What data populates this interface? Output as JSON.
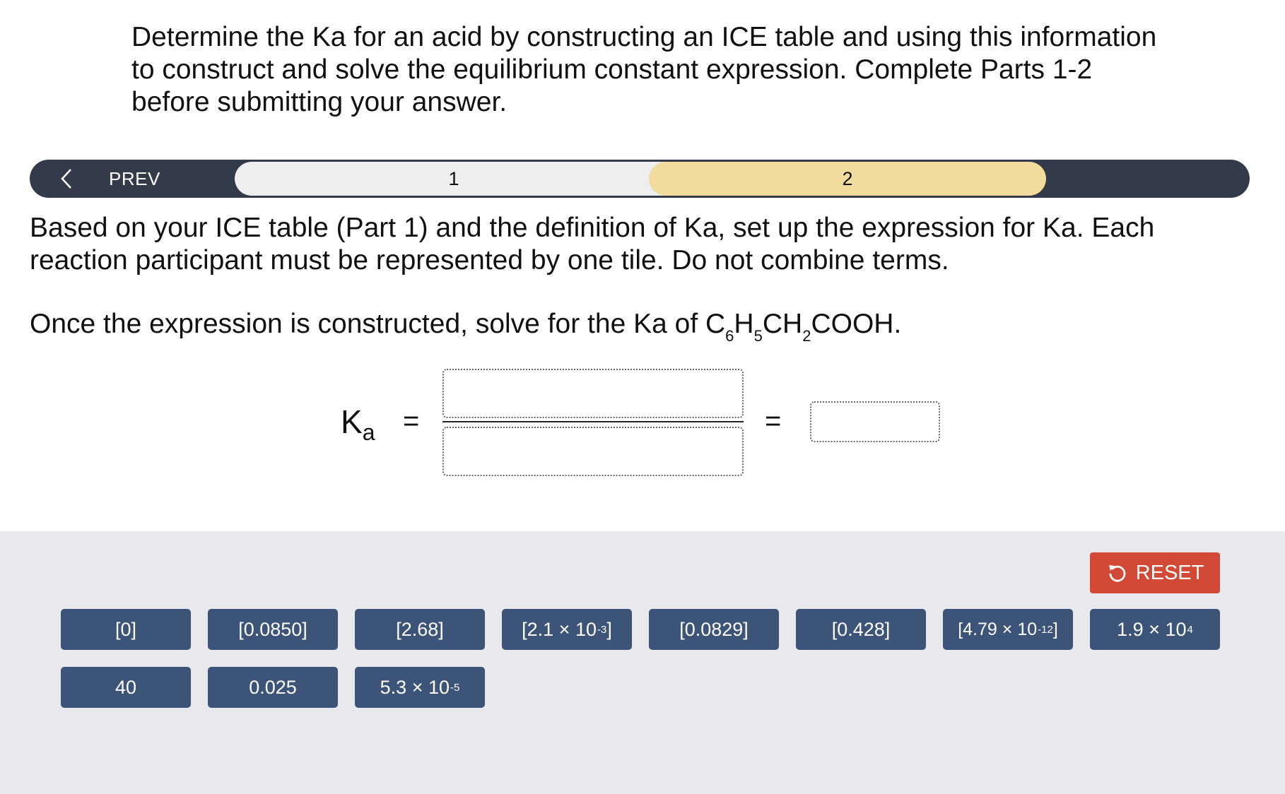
{
  "intro": "Determine the Ka for an acid by constructing an ICE table and using this information to construct and solve the equilibrium constant expression. Complete Parts 1-2 before submitting your answer.",
  "nav": {
    "prev_label": "PREV",
    "part1_label": "1",
    "part2_label": "2"
  },
  "instructions": {
    "line1": "Based on your ICE table (Part 1) and the definition of Ka, set up the expression for Ka. Each reaction participant must be represented by one tile. Do not combine terms.",
    "line2_prefix": "Once the expression is constructed, solve for the Ka of C",
    "formula_6": "6",
    "formula_H": "H",
    "formula_5": "5",
    "formula_CH": "CH",
    "formula_2": "2",
    "formula_COOH": "COOH."
  },
  "expression": {
    "ka_K": "K",
    "ka_sub": "a",
    "equals": "="
  },
  "reset_label": "RESET",
  "tiles": {
    "t0": "[0]",
    "t1": "[0.0850]",
    "t2": "[2.68]",
    "t3_base": "[2.1 × 10",
    "t3_exp": "-3",
    "t3_end": "]",
    "t4": "[0.0829]",
    "t5": "[0.428]",
    "t6_base": "[4.79 × 10",
    "t6_exp": "-12",
    "t6_end": "]",
    "t7_base": "1.9 × 10",
    "t7_exp": "4",
    "t8": "40",
    "t9": "0.025",
    "t10_base": "5.3 × 10",
    "t10_exp": "-5"
  },
  "colors": {
    "navbar": "#333b4b",
    "part1_bg": "#eeeeee",
    "part2_bg": "#f1dc9e",
    "tray": "#e9e9ed",
    "tile": "#3c5478",
    "reset": "#d24a35"
  }
}
